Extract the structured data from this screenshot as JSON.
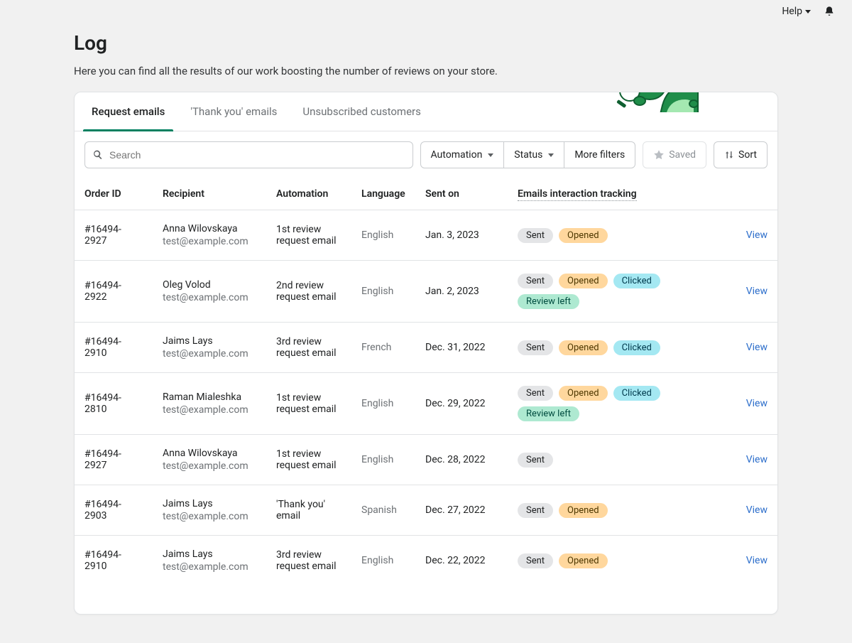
{
  "topbar": {
    "help": "Help"
  },
  "page": {
    "title": "Log",
    "subtitle": "Here you can find all the results of our work boosting the number of reviews on your store."
  },
  "tabs": [
    {
      "label": "Request emails",
      "active": true
    },
    {
      "label": "'Thank you' emails",
      "active": false
    },
    {
      "label": "Unsubscribed customers",
      "active": false
    }
  ],
  "filters": {
    "search_placeholder": "Search",
    "automation": "Automation",
    "status": "Status",
    "more": "More filters",
    "saved": "Saved",
    "sort": "Sort"
  },
  "columns": {
    "order": "Order ID",
    "recipient": "Recipient",
    "automation": "Automation",
    "language": "Language",
    "sent": "Sent on",
    "tracking": "Emails interaction tracking",
    "view": "View"
  },
  "badge_labels": {
    "sent": "Sent",
    "opened": "Opened",
    "clicked": "Clicked",
    "review": "Review left"
  },
  "rows": [
    {
      "order": "#16494-2927",
      "name": "Anna Wilovskaya",
      "email": "test@example.com",
      "automation": "1st review request email",
      "language": "English",
      "sent": "Jan. 3, 2023",
      "badges": [
        "sent",
        "opened"
      ]
    },
    {
      "order": "#16494-2922",
      "name": "Oleg Volod",
      "email": "test@example.com",
      "automation": "2nd review request email",
      "language": "English",
      "sent": "Jan. 2, 2023",
      "badges": [
        "sent",
        "opened",
        "clicked",
        "review"
      ]
    },
    {
      "order": "#16494-2910",
      "name": "Jaims Lays",
      "email": "test@example.com",
      "automation": "3rd review request email",
      "language": "French",
      "sent": "Dec. 31, 2022",
      "badges": [
        "sent",
        "opened",
        "clicked"
      ]
    },
    {
      "order": "#16494-2810",
      "name": "Raman Mialeshka",
      "email": "test@example.com",
      "automation": "1st review request email",
      "language": "English",
      "sent": "Dec. 29, 2022",
      "badges": [
        "sent",
        "opened",
        "clicked",
        "review"
      ]
    },
    {
      "order": "#16494-2927",
      "name": "Anna Wilovskaya",
      "email": "test@example.com",
      "automation": "1st review request email",
      "language": "English",
      "sent": "Dec. 28, 2022",
      "badges": [
        "sent"
      ]
    },
    {
      "order": "#16494-2903",
      "name": "Jaims Lays",
      "email": "test@example.com",
      "automation": "'Thank you' email",
      "language": "Spanish",
      "sent": "Dec. 27, 2022",
      "badges": [
        "sent",
        "opened"
      ]
    },
    {
      "order": "#16494-2910",
      "name": "Jaims Lays",
      "email": "test@example.com",
      "automation": "3rd review request email",
      "language": "English",
      "sent": "Dec. 22, 2022",
      "badges": [
        "sent",
        "opened"
      ]
    }
  ]
}
